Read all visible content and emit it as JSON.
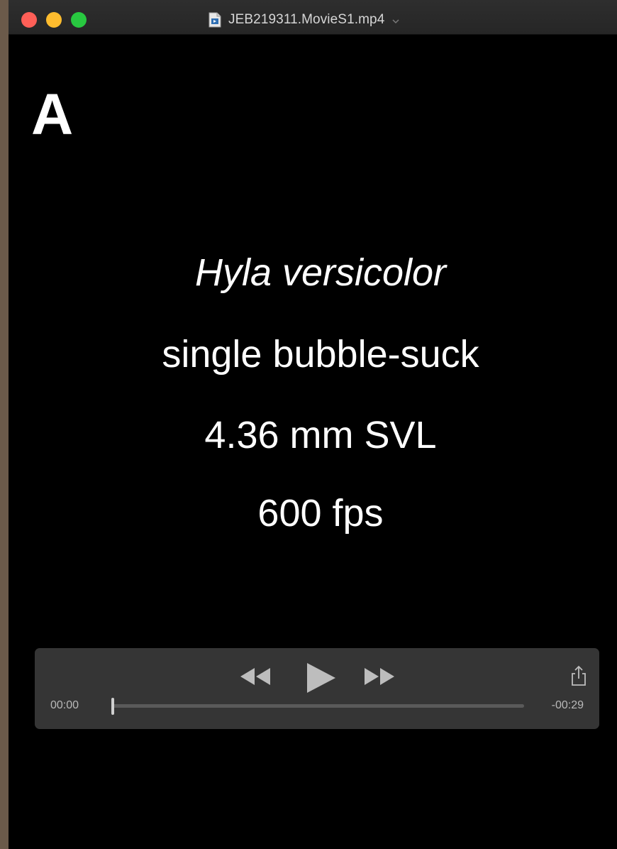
{
  "window": {
    "title": "JEB219311.MovieS1.mp4"
  },
  "video": {
    "panel_letter": "A",
    "captions": {
      "species": "Hyla versicolor",
      "behavior": "single bubble-suck",
      "size": "4.36 mm SVL",
      "framerate": "600 fps"
    }
  },
  "player": {
    "elapsed": "00:00",
    "remaining": "-00:29",
    "progress_fraction": 0.0,
    "icons": {
      "rewind": "rewind-icon",
      "play": "play-icon",
      "fast_forward": "fast-forward-icon",
      "share": "share-icon"
    }
  },
  "colors": {
    "close": "#ff5f57",
    "minimize": "#febc2e",
    "maximize": "#28c840",
    "background": "#000000"
  }
}
